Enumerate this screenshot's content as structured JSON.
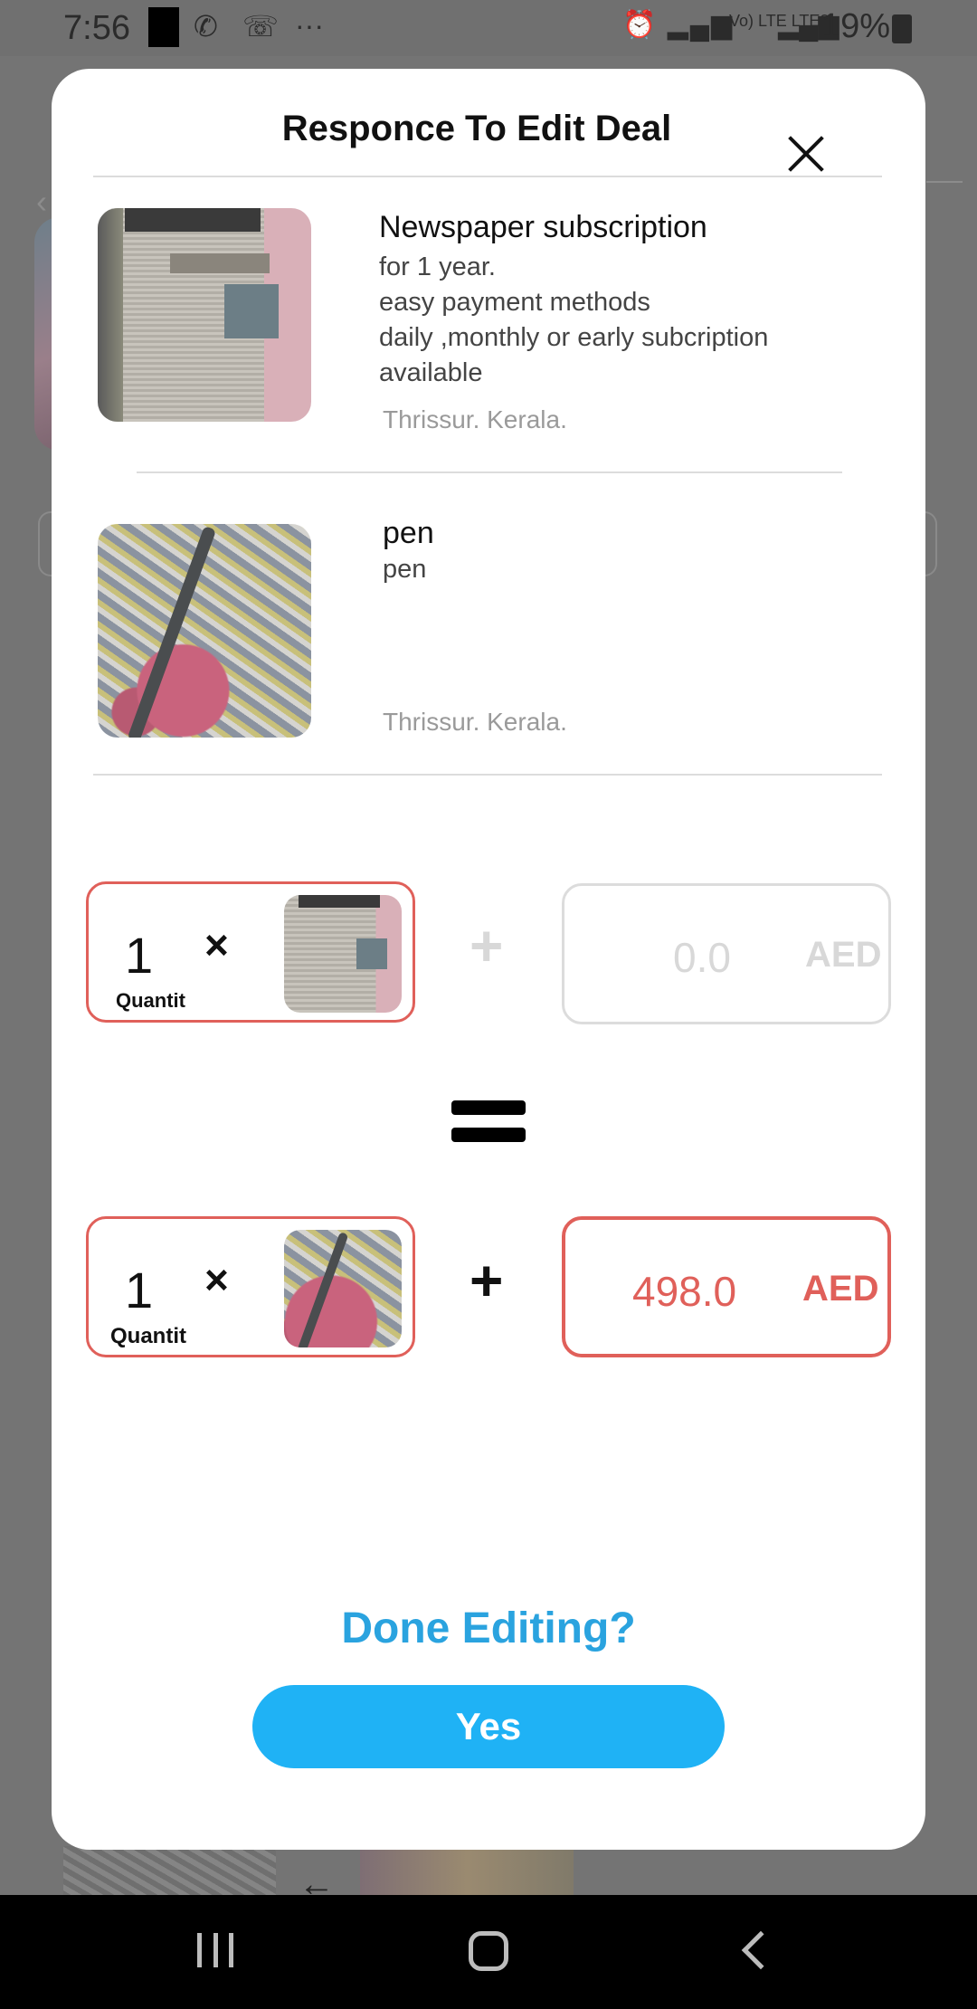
{
  "status_bar": {
    "time": "7:56",
    "network": "Vo) LTE LTE2",
    "battery": "19%"
  },
  "modal": {
    "title": "Responce To Edit Deal",
    "items": [
      {
        "title": "Newspaper subscription",
        "description": [
          "for 1 year.",
          "easy payment methods",
          "daily ,monthly or early subcription",
          "available"
        ],
        "location": "Thrissur. Kerala."
      },
      {
        "title": "pen",
        "description": [
          "pen"
        ],
        "location": "Thrissur. Kerala."
      }
    ],
    "offer_row_1": {
      "quantity": "1",
      "times": "×",
      "quantity_label": "Quantit",
      "plus": "+",
      "price": "0.0",
      "currency": "AED"
    },
    "equals": "=",
    "offer_row_2": {
      "quantity": "1",
      "times": "×",
      "quantity_label": "Quantit",
      "plus": "+",
      "price": "498.0",
      "currency": "AED"
    },
    "done_label": "Done Editing?",
    "yes_label": "Yes"
  },
  "colors": {
    "accent_blue": "#1fb2f5",
    "accent_red": "#e0605a",
    "muted_gray": "#d8d8d8"
  }
}
